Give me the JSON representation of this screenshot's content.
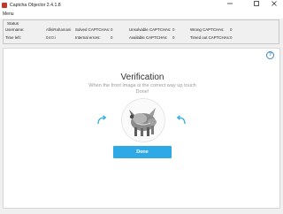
{
  "window": {
    "title": "Captcha Objector 2.4.1.8",
    "minimize_icon": "minimize-icon",
    "maximize_icon": "maximize-icon",
    "close_icon": "close-icon"
  },
  "menu": {
    "items": [
      "Menu"
    ]
  },
  "status": {
    "title": "Status",
    "username_label": "Username:",
    "username_value": "AfikiRahamani",
    "time_left_label": "Time left:",
    "time_left_value": "04:0:i",
    "solved_label": "Solved CAPTCHAs:",
    "solved_value": "0",
    "internal_errors_label": "Internal errors:",
    "internal_errors_value": "0",
    "unsolvable_label": "Unsolvable CAPTCHAs:",
    "unsolvable_value": "0",
    "available_label": "Available CAPTCHAs:",
    "available_value": "0",
    "wrong_label": "Wrong CAPTCHAs:",
    "wrong_value": "0",
    "timed_out_label": "Timed out CAPTCHAs:",
    "timed_out_value": "0"
  },
  "captcha": {
    "title": "Verification",
    "subtitle": "When the front image is the correct way up touch Done!",
    "done_label": "Done",
    "help_icon": "help-icon",
    "rotate_left_icon": "rotate-left-icon",
    "rotate_right_icon": "rotate-right-icon",
    "accent_color": "#2ea9e6"
  }
}
